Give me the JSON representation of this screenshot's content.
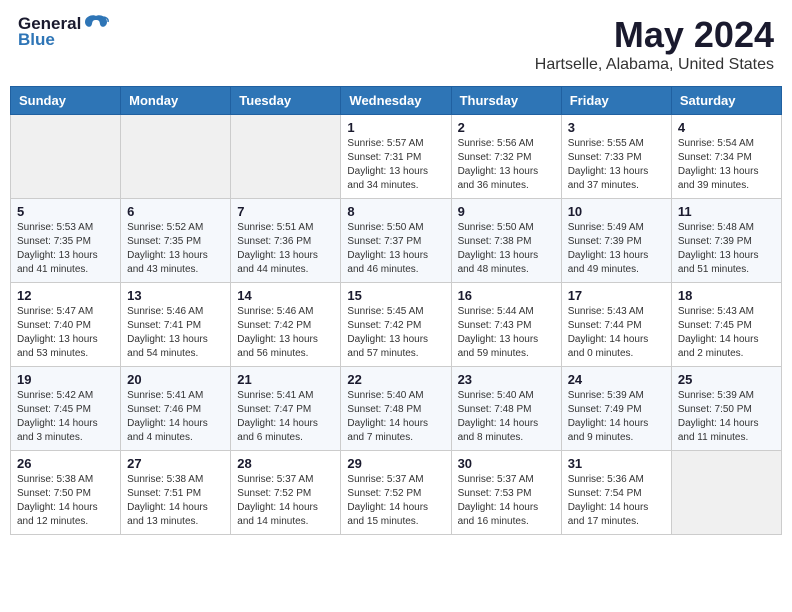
{
  "logo": {
    "general": "General",
    "blue": "Blue"
  },
  "title": "May 2024",
  "subtitle": "Hartselle, Alabama, United States",
  "days_of_week": [
    "Sunday",
    "Monday",
    "Tuesday",
    "Wednesday",
    "Thursday",
    "Friday",
    "Saturday"
  ],
  "weeks": [
    [
      {
        "day": "",
        "info": ""
      },
      {
        "day": "",
        "info": ""
      },
      {
        "day": "",
        "info": ""
      },
      {
        "day": "1",
        "info": "Sunrise: 5:57 AM\nSunset: 7:31 PM\nDaylight: 13 hours\nand 34 minutes."
      },
      {
        "day": "2",
        "info": "Sunrise: 5:56 AM\nSunset: 7:32 PM\nDaylight: 13 hours\nand 36 minutes."
      },
      {
        "day": "3",
        "info": "Sunrise: 5:55 AM\nSunset: 7:33 PM\nDaylight: 13 hours\nand 37 minutes."
      },
      {
        "day": "4",
        "info": "Sunrise: 5:54 AM\nSunset: 7:34 PM\nDaylight: 13 hours\nand 39 minutes."
      }
    ],
    [
      {
        "day": "5",
        "info": "Sunrise: 5:53 AM\nSunset: 7:35 PM\nDaylight: 13 hours\nand 41 minutes."
      },
      {
        "day": "6",
        "info": "Sunrise: 5:52 AM\nSunset: 7:35 PM\nDaylight: 13 hours\nand 43 minutes."
      },
      {
        "day": "7",
        "info": "Sunrise: 5:51 AM\nSunset: 7:36 PM\nDaylight: 13 hours\nand 44 minutes."
      },
      {
        "day": "8",
        "info": "Sunrise: 5:50 AM\nSunset: 7:37 PM\nDaylight: 13 hours\nand 46 minutes."
      },
      {
        "day": "9",
        "info": "Sunrise: 5:50 AM\nSunset: 7:38 PM\nDaylight: 13 hours\nand 48 minutes."
      },
      {
        "day": "10",
        "info": "Sunrise: 5:49 AM\nSunset: 7:39 PM\nDaylight: 13 hours\nand 49 minutes."
      },
      {
        "day": "11",
        "info": "Sunrise: 5:48 AM\nSunset: 7:39 PM\nDaylight: 13 hours\nand 51 minutes."
      }
    ],
    [
      {
        "day": "12",
        "info": "Sunrise: 5:47 AM\nSunset: 7:40 PM\nDaylight: 13 hours\nand 53 minutes."
      },
      {
        "day": "13",
        "info": "Sunrise: 5:46 AM\nSunset: 7:41 PM\nDaylight: 13 hours\nand 54 minutes."
      },
      {
        "day": "14",
        "info": "Sunrise: 5:46 AM\nSunset: 7:42 PM\nDaylight: 13 hours\nand 56 minutes."
      },
      {
        "day": "15",
        "info": "Sunrise: 5:45 AM\nSunset: 7:42 PM\nDaylight: 13 hours\nand 57 minutes."
      },
      {
        "day": "16",
        "info": "Sunrise: 5:44 AM\nSunset: 7:43 PM\nDaylight: 13 hours\nand 59 minutes."
      },
      {
        "day": "17",
        "info": "Sunrise: 5:43 AM\nSunset: 7:44 PM\nDaylight: 14 hours\nand 0 minutes."
      },
      {
        "day": "18",
        "info": "Sunrise: 5:43 AM\nSunset: 7:45 PM\nDaylight: 14 hours\nand 2 minutes."
      }
    ],
    [
      {
        "day": "19",
        "info": "Sunrise: 5:42 AM\nSunset: 7:45 PM\nDaylight: 14 hours\nand 3 minutes."
      },
      {
        "day": "20",
        "info": "Sunrise: 5:41 AM\nSunset: 7:46 PM\nDaylight: 14 hours\nand 4 minutes."
      },
      {
        "day": "21",
        "info": "Sunrise: 5:41 AM\nSunset: 7:47 PM\nDaylight: 14 hours\nand 6 minutes."
      },
      {
        "day": "22",
        "info": "Sunrise: 5:40 AM\nSunset: 7:48 PM\nDaylight: 14 hours\nand 7 minutes."
      },
      {
        "day": "23",
        "info": "Sunrise: 5:40 AM\nSunset: 7:48 PM\nDaylight: 14 hours\nand 8 minutes."
      },
      {
        "day": "24",
        "info": "Sunrise: 5:39 AM\nSunset: 7:49 PM\nDaylight: 14 hours\nand 9 minutes."
      },
      {
        "day": "25",
        "info": "Sunrise: 5:39 AM\nSunset: 7:50 PM\nDaylight: 14 hours\nand 11 minutes."
      }
    ],
    [
      {
        "day": "26",
        "info": "Sunrise: 5:38 AM\nSunset: 7:50 PM\nDaylight: 14 hours\nand 12 minutes."
      },
      {
        "day": "27",
        "info": "Sunrise: 5:38 AM\nSunset: 7:51 PM\nDaylight: 14 hours\nand 13 minutes."
      },
      {
        "day": "28",
        "info": "Sunrise: 5:37 AM\nSunset: 7:52 PM\nDaylight: 14 hours\nand 14 minutes."
      },
      {
        "day": "29",
        "info": "Sunrise: 5:37 AM\nSunset: 7:52 PM\nDaylight: 14 hours\nand 15 minutes."
      },
      {
        "day": "30",
        "info": "Sunrise: 5:37 AM\nSunset: 7:53 PM\nDaylight: 14 hours\nand 16 minutes."
      },
      {
        "day": "31",
        "info": "Sunrise: 5:36 AM\nSunset: 7:54 PM\nDaylight: 14 hours\nand 17 minutes."
      },
      {
        "day": "",
        "info": ""
      }
    ]
  ]
}
